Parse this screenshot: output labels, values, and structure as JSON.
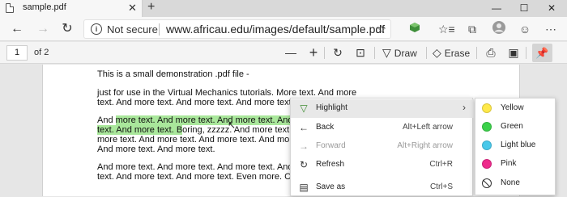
{
  "tab": {
    "title": "sample.pdf",
    "close": "✕",
    "new_tab": "+"
  },
  "window": {
    "minimize": "—",
    "maximize": "☐",
    "close": "✕"
  },
  "address": {
    "security_label": "Not secure",
    "url": "www.africau.edu/images/default/sample.pdf"
  },
  "pdf_toolbar": {
    "page_number": "1",
    "page_of": "of 2",
    "draw_label": "Draw",
    "erase_label": "Erase"
  },
  "document": {
    "lines": [
      "This is a small demonstration .pdf file -",
      "just for use in the Virtual Mechanics tutorials. More text. And more",
      "text. And more text. And more text. And more text."
    ],
    "para2": {
      "l1_pre": "And ",
      "l1_hl": "more text. And more text. And more text. And more",
      "l2_hl": "text. And more text. B",
      "l2_post": "oring, zzzzz. And more text. And more",
      "l3": "more text. And more text. And more text. And more text. And more text.",
      "l4": "And more text. And more text."
    },
    "para3": {
      "l1": "And more text. And more text. And more text. And more text. And more",
      "l2": "text. And more text. And more text. Even more. Continued on page 2 ..."
    }
  },
  "context_menu": {
    "items": [
      {
        "label": "Highlight",
        "shortcut": "",
        "has_submenu": true,
        "state": "active"
      },
      {
        "label": "Back",
        "shortcut": "Alt+Left arrow",
        "state": "normal"
      },
      {
        "label": "Forward",
        "shortcut": "Alt+Right arrow",
        "state": "disabled"
      },
      {
        "label": "Refresh",
        "shortcut": "Ctrl+R",
        "state": "normal"
      },
      {
        "label": "Save as",
        "shortcut": "Ctrl+S",
        "state": "normal"
      }
    ]
  },
  "highlight_submenu": {
    "items": [
      {
        "label": "Yellow",
        "color": "#ffe94a"
      },
      {
        "label": "Green",
        "color": "#3bd14a"
      },
      {
        "label": "Light blue",
        "color": "#48c8ea"
      },
      {
        "label": "Pink",
        "color": "#ee2a8c"
      },
      {
        "label": "None",
        "color": ""
      }
    ]
  },
  "colors": {
    "highlight": "#a9e79b",
    "menu_active": "#e8e8e8"
  }
}
